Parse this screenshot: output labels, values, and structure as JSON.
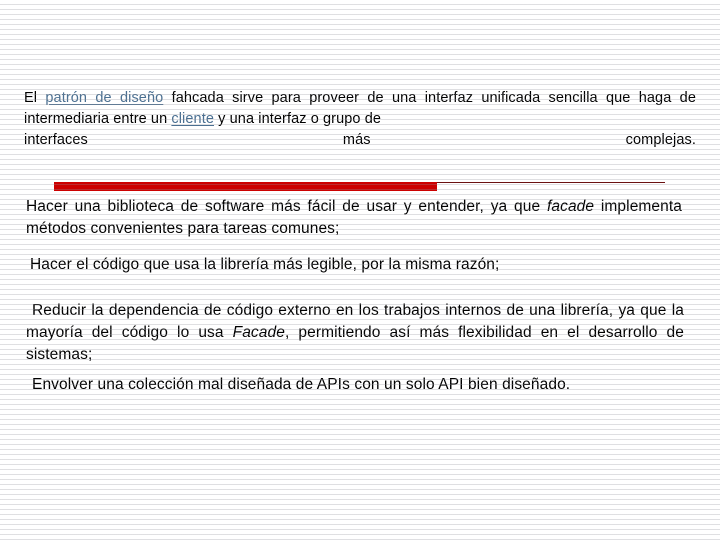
{
  "slide": {
    "intro": {
      "segments": [
        {
          "type": "text",
          "value": "El "
        },
        {
          "type": "link",
          "value": "patrón de diseño"
        },
        {
          "type": "text",
          "value": " fahcada sirve para proveer de una interfaz unificada sencilla que haga de intermediaria entre un "
        },
        {
          "type": "link",
          "value": "cliente"
        },
        {
          "type": "text",
          "value": " y una interfaz o grupo de "
        }
      ],
      "lead_text_1": "El ",
      "link_1": "patrón de diseño",
      "mid_text": " fahcada sirve para proveer de una interfaz unificada sencilla que haga de intermediaria entre un ",
      "link_2": "cliente",
      "tail_text": " y una interfaz o grupo de ",
      "last_line_word_1": "interfaces",
      "last_line_word_2": "más",
      "last_line_word_3": "complejas.",
      "link_color": "#4a6f91"
    },
    "divider": {
      "bar_color": "#cc0000",
      "line_color": "#6b1111"
    },
    "paragraphs": [
      {
        "id": "para-1",
        "before_italic": "Hacer una biblioteca de software más fácil de usar y entender, ya que ",
        "italic": "facade",
        "after_italic": " implementa métodos convenientes para tareas comunes;"
      },
      {
        "id": "para-2",
        "before_italic": "Hacer el código que usa la librería más legible, por la misma razón;",
        "italic": "",
        "after_italic": ""
      },
      {
        "id": "para-3",
        "before_italic": "Reducir la dependencia de código externo en los trabajos internos de una librería, ya que la mayoría del código lo usa ",
        "italic": "Facade",
        "after_italic": ", permitiendo así más flexibilidad en el desarrollo de sistemas;"
      },
      {
        "id": "para-4",
        "before_italic": "Envolver una colección mal diseñada de APIs con un solo API bien diseñado.",
        "italic": "",
        "after_italic": ""
      }
    ]
  }
}
